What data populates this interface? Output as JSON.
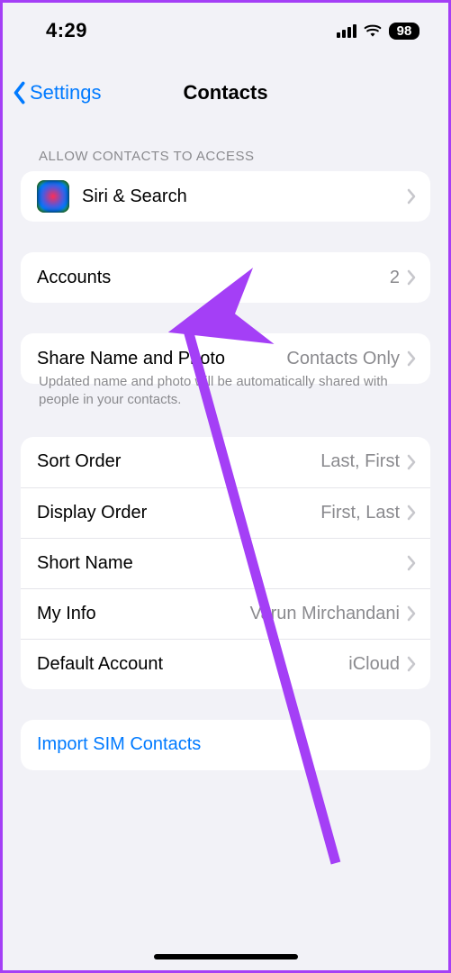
{
  "status": {
    "time": "4:29",
    "battery": "98"
  },
  "nav": {
    "back": "Settings",
    "title": "Contacts"
  },
  "sections": {
    "access_header": "ALLOW CONTACTS TO ACCESS",
    "siri": {
      "label": "Siri & Search"
    },
    "accounts": {
      "label": "Accounts",
      "value": "2"
    },
    "share": {
      "label": "Share Name and Photo",
      "value": "Contacts Only"
    },
    "share_note": "Updated name and photo will be automatically shared with people in your contacts.",
    "sort": {
      "label": "Sort Order",
      "value": "Last, First"
    },
    "display": {
      "label": "Display Order",
      "value": "First, Last"
    },
    "short": {
      "label": "Short Name"
    },
    "myinfo": {
      "label": "My Info",
      "value": "Varun Mirchandani"
    },
    "default": {
      "label": "Default Account",
      "value": "iCloud"
    },
    "import": {
      "label": "Import SIM Contacts"
    }
  },
  "colors": {
    "accent": "#007aff",
    "arrow": "#a43ff6"
  }
}
